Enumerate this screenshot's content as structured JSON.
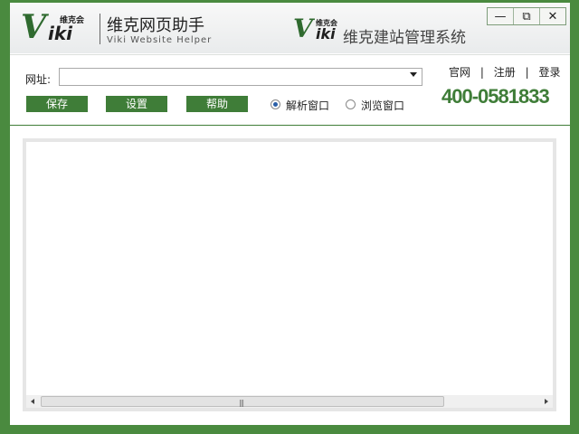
{
  "app": {
    "brand_logo_v": "V",
    "brand_logo_iki": "iki",
    "brand_logo_small": "维克会",
    "title": "维克网页助手",
    "subtitle": "Viki Website Helper",
    "brand2_small": "维克会",
    "brand2_text": "维克建站管理系统"
  },
  "window_controls": {
    "minimize": "—",
    "restore": "⧉",
    "close": "✕"
  },
  "toolbar": {
    "url_label": "网址:",
    "url_value": "",
    "save_label": "保存",
    "settings_label": "设置",
    "help_label": "帮助",
    "radio_parse_label": "解析窗口",
    "radio_browse_label": "浏览窗口",
    "selected_radio": "解析窗口"
  },
  "links": {
    "official": "官网",
    "register": "注册",
    "login": "登录",
    "separator": "|"
  },
  "phone": "400-0581833",
  "scrollbar": {
    "grip": "|||"
  },
  "colors": {
    "frame_green": "#4a8a3f",
    "button_green": "#3f7d38",
    "radio_dot": "#2a5fa8"
  }
}
